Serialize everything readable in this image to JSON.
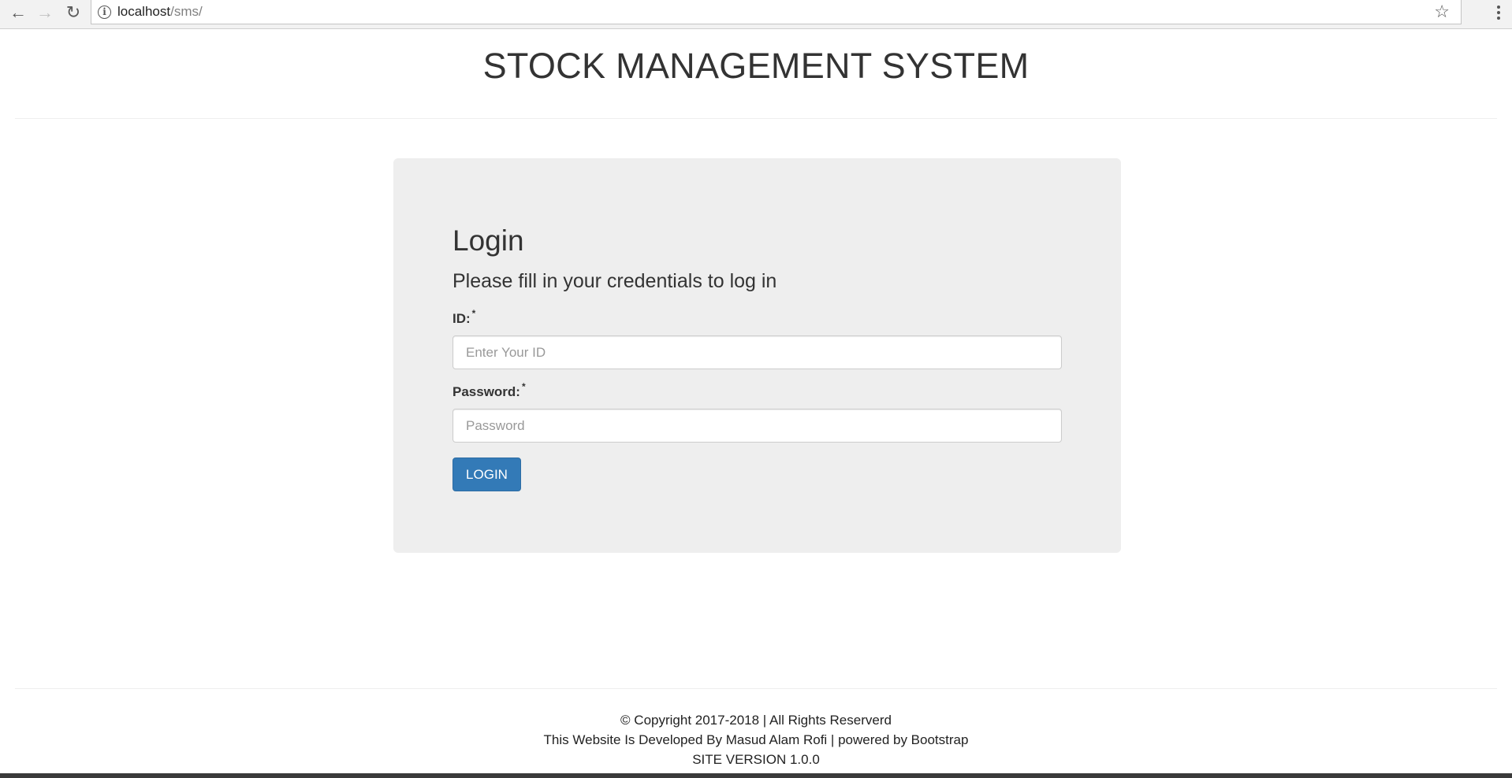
{
  "browser": {
    "url_host": "localhost",
    "url_path": "/sms/",
    "back_icon": "arrow-left",
    "forward_icon": "arrow-right",
    "reload_icon": "reload",
    "info_icon": "info-circle",
    "bookmark_icon": "star-outline",
    "menu_icon": "vertical-dots"
  },
  "header": {
    "title": "STOCK MANAGEMENT SYSTEM"
  },
  "login": {
    "heading": "Login",
    "subheading": "Please fill in your credentials to log in",
    "id_label": "ID:",
    "id_required": "*",
    "id_placeholder": "Enter Your ID",
    "password_label": "Password:",
    "password_required": "*",
    "password_placeholder": "Password",
    "button_label": "LOGIN",
    "button_color": "#337ab7"
  },
  "footer": {
    "copyright": "© Copyright 2017-2018 | All Rights Reserverd",
    "developer": "This Website Is Developed By Masud Alam Rofi | powered by Bootstrap",
    "version": "SITE VERSION 1.0.0"
  }
}
